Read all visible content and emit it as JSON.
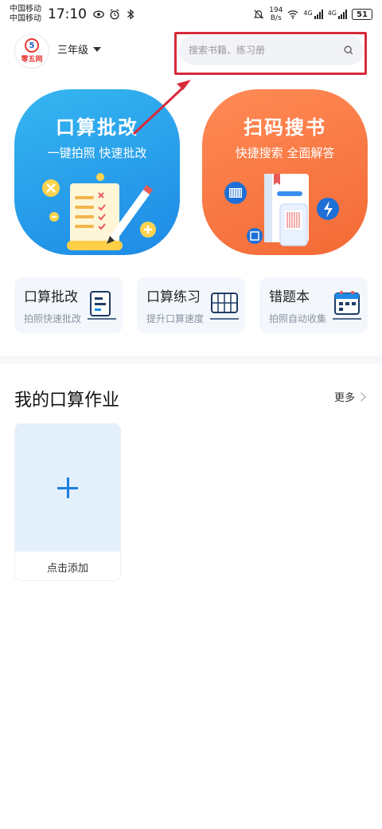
{
  "status_bar": {
    "carrier_1": "中国移动",
    "carrier_2": "中国移动",
    "time": "17:10",
    "net_speed_value": "194",
    "net_speed_unit": "B/s",
    "signal_1_label": "4G",
    "signal_2_label": "4G",
    "battery": "51"
  },
  "header": {
    "logo_text": "零五网",
    "logo_number": "5",
    "grade": "三年级",
    "search_placeholder": "搜索书籍、练习册"
  },
  "big_cards": [
    {
      "title": "口算批改",
      "subtitle": "一键拍照 快速批改",
      "color": "#1e8ae6"
    },
    {
      "title": "扫码搜书",
      "subtitle": "快捷搜索 全面解答",
      "color": "#f36a36"
    }
  ],
  "small_cards": [
    {
      "title": "口算批改",
      "subtitle": "拍照快速批改"
    },
    {
      "title": "口算练习",
      "subtitle": "提升口算速度"
    },
    {
      "title": "错题本",
      "subtitle": "拍照自动收集"
    }
  ],
  "homework": {
    "title": "我的口算作业",
    "more": "更多",
    "add_label": "点击添加"
  },
  "colors": {
    "highlight_red": "#d72a3a",
    "accent_blue": "#1a7fe0"
  }
}
